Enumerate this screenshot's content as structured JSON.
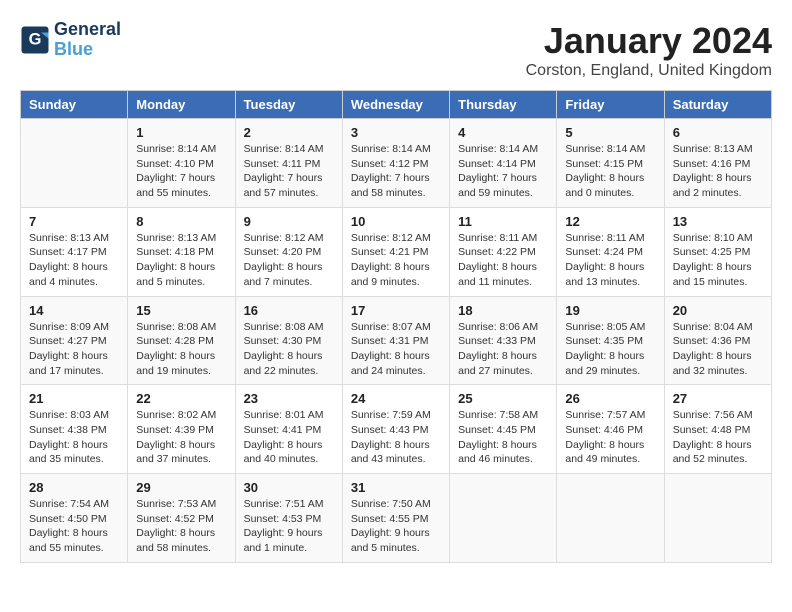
{
  "header": {
    "logo_line1": "General",
    "logo_line2": "Blue",
    "month_title": "January 2024",
    "location": "Corston, England, United Kingdom"
  },
  "weekdays": [
    "Sunday",
    "Monday",
    "Tuesday",
    "Wednesday",
    "Thursday",
    "Friday",
    "Saturday"
  ],
  "weeks": [
    [
      {
        "day": "",
        "info": ""
      },
      {
        "day": "1",
        "info": "Sunrise: 8:14 AM\nSunset: 4:10 PM\nDaylight: 7 hours\nand 55 minutes."
      },
      {
        "day": "2",
        "info": "Sunrise: 8:14 AM\nSunset: 4:11 PM\nDaylight: 7 hours\nand 57 minutes."
      },
      {
        "day": "3",
        "info": "Sunrise: 8:14 AM\nSunset: 4:12 PM\nDaylight: 7 hours\nand 58 minutes."
      },
      {
        "day": "4",
        "info": "Sunrise: 8:14 AM\nSunset: 4:14 PM\nDaylight: 7 hours\nand 59 minutes."
      },
      {
        "day": "5",
        "info": "Sunrise: 8:14 AM\nSunset: 4:15 PM\nDaylight: 8 hours\nand 0 minutes."
      },
      {
        "day": "6",
        "info": "Sunrise: 8:13 AM\nSunset: 4:16 PM\nDaylight: 8 hours\nand 2 minutes."
      }
    ],
    [
      {
        "day": "7",
        "info": "Sunrise: 8:13 AM\nSunset: 4:17 PM\nDaylight: 8 hours\nand 4 minutes."
      },
      {
        "day": "8",
        "info": "Sunrise: 8:13 AM\nSunset: 4:18 PM\nDaylight: 8 hours\nand 5 minutes."
      },
      {
        "day": "9",
        "info": "Sunrise: 8:12 AM\nSunset: 4:20 PM\nDaylight: 8 hours\nand 7 minutes."
      },
      {
        "day": "10",
        "info": "Sunrise: 8:12 AM\nSunset: 4:21 PM\nDaylight: 8 hours\nand 9 minutes."
      },
      {
        "day": "11",
        "info": "Sunrise: 8:11 AM\nSunset: 4:22 PM\nDaylight: 8 hours\nand 11 minutes."
      },
      {
        "day": "12",
        "info": "Sunrise: 8:11 AM\nSunset: 4:24 PM\nDaylight: 8 hours\nand 13 minutes."
      },
      {
        "day": "13",
        "info": "Sunrise: 8:10 AM\nSunset: 4:25 PM\nDaylight: 8 hours\nand 15 minutes."
      }
    ],
    [
      {
        "day": "14",
        "info": "Sunrise: 8:09 AM\nSunset: 4:27 PM\nDaylight: 8 hours\nand 17 minutes."
      },
      {
        "day": "15",
        "info": "Sunrise: 8:08 AM\nSunset: 4:28 PM\nDaylight: 8 hours\nand 19 minutes."
      },
      {
        "day": "16",
        "info": "Sunrise: 8:08 AM\nSunset: 4:30 PM\nDaylight: 8 hours\nand 22 minutes."
      },
      {
        "day": "17",
        "info": "Sunrise: 8:07 AM\nSunset: 4:31 PM\nDaylight: 8 hours\nand 24 minutes."
      },
      {
        "day": "18",
        "info": "Sunrise: 8:06 AM\nSunset: 4:33 PM\nDaylight: 8 hours\nand 27 minutes."
      },
      {
        "day": "19",
        "info": "Sunrise: 8:05 AM\nSunset: 4:35 PM\nDaylight: 8 hours\nand 29 minutes."
      },
      {
        "day": "20",
        "info": "Sunrise: 8:04 AM\nSunset: 4:36 PM\nDaylight: 8 hours\nand 32 minutes."
      }
    ],
    [
      {
        "day": "21",
        "info": "Sunrise: 8:03 AM\nSunset: 4:38 PM\nDaylight: 8 hours\nand 35 minutes."
      },
      {
        "day": "22",
        "info": "Sunrise: 8:02 AM\nSunset: 4:39 PM\nDaylight: 8 hours\nand 37 minutes."
      },
      {
        "day": "23",
        "info": "Sunrise: 8:01 AM\nSunset: 4:41 PM\nDaylight: 8 hours\nand 40 minutes."
      },
      {
        "day": "24",
        "info": "Sunrise: 7:59 AM\nSunset: 4:43 PM\nDaylight: 8 hours\nand 43 minutes."
      },
      {
        "day": "25",
        "info": "Sunrise: 7:58 AM\nSunset: 4:45 PM\nDaylight: 8 hours\nand 46 minutes."
      },
      {
        "day": "26",
        "info": "Sunrise: 7:57 AM\nSunset: 4:46 PM\nDaylight: 8 hours\nand 49 minutes."
      },
      {
        "day": "27",
        "info": "Sunrise: 7:56 AM\nSunset: 4:48 PM\nDaylight: 8 hours\nand 52 minutes."
      }
    ],
    [
      {
        "day": "28",
        "info": "Sunrise: 7:54 AM\nSunset: 4:50 PM\nDaylight: 8 hours\nand 55 minutes."
      },
      {
        "day": "29",
        "info": "Sunrise: 7:53 AM\nSunset: 4:52 PM\nDaylight: 8 hours\nand 58 minutes."
      },
      {
        "day": "30",
        "info": "Sunrise: 7:51 AM\nSunset: 4:53 PM\nDaylight: 9 hours\nand 1 minute."
      },
      {
        "day": "31",
        "info": "Sunrise: 7:50 AM\nSunset: 4:55 PM\nDaylight: 9 hours\nand 5 minutes."
      },
      {
        "day": "",
        "info": ""
      },
      {
        "day": "",
        "info": ""
      },
      {
        "day": "",
        "info": ""
      }
    ]
  ]
}
